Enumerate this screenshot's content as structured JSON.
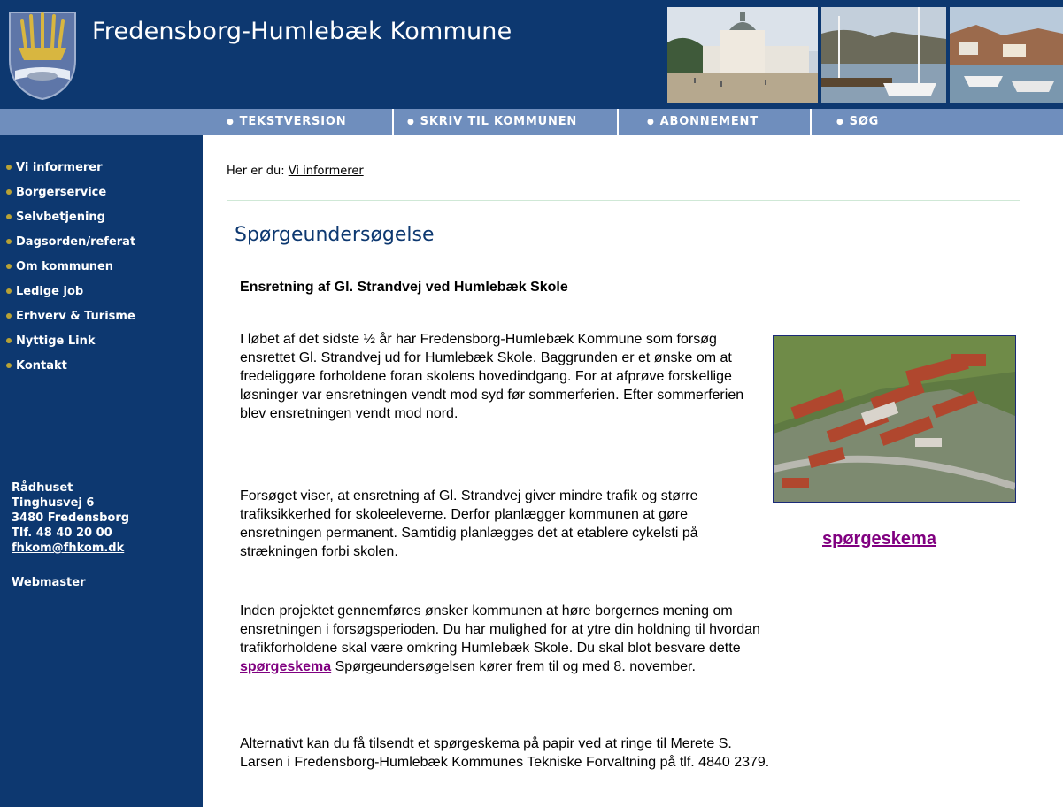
{
  "header": {
    "title": "Fredensborg-Humlebæk Kommune"
  },
  "nav": [
    {
      "label": "TEKSTVERSION"
    },
    {
      "label": "SKRIV TIL KOMMUNEN"
    },
    {
      "label": "ABONNEMENT"
    },
    {
      "label": "SØG"
    }
  ],
  "sidebar": {
    "items": [
      {
        "label": "Vi informerer"
      },
      {
        "label": "Borgerservice"
      },
      {
        "label": "Selvbetjening"
      },
      {
        "label": "Dagsorden/referat"
      },
      {
        "label": "Om kommunen"
      },
      {
        "label": "Ledige job"
      },
      {
        "label": "Erhverv & Turisme"
      },
      {
        "label": "Nyttige Link"
      },
      {
        "label": "Kontakt"
      }
    ],
    "address": {
      "line1": "Rådhuset",
      "line2": "Tinghusvej 6",
      "line3": "3480 Fredensborg",
      "phone": "Tlf. 48 40 20 00",
      "email": "fhkom@fhkom.dk"
    },
    "webmaster": "Webmaster"
  },
  "breadcrumb": {
    "prefix": "Her er du:",
    "link": "Vi informerer"
  },
  "main": {
    "title": "Spørgeundersøgelse",
    "subtitle": "Ensretning af Gl. Strandvej ved Humlebæk Skole",
    "para1": "I løbet af det sidste ½ år har Fredensborg-Humlebæk Kommune som forsøg ensrettet Gl. Strandvej ud for Humlebæk Skole. Baggrunden er et ønske om at fredeliggøre forholdene foran skolens hovedindgang. For at afprøve forskellige løsninger var ensretningen vendt mod syd før sommerferien. Efter sommerferien blev ensretningen vendt mod nord.",
    "para2": "Forsøget viser, at ensretning af Gl. Strandvej giver mindre trafik og større trafiksikkerhed for skoleeleverne. Derfor planlægger kommunen at gøre ensretningen permanent. Samtidig planlægges det at etablere cykelsti på strækningen forbi skolen.",
    "para3_before": "Inden projektet gennemføres ønsker kommunen at høre borgernes mening om ensretningen i forsøgsperioden. Du har mulighed for at ytre din holdning til hvordan trafikforholdene skal være omkring Humlebæk Skole. Du skal blot besvare dette",
    "para3_link": "spørgeskema",
    "para3_after": "Spørgeundersøgelsen kører frem til og med 8. november.",
    "para4": "Alternativt kan du få tilsendt et spørgeskema på papir ved at ringe til Merete S. Larsen i Fredensborg-Humlebæk Kommunes Tekniske Forvaltning på tlf. 4840 2379.",
    "side_link": "spørgeskema"
  },
  "colors": {
    "navy": "#0d3870",
    "navbar": "#6f8ebd",
    "bullet": "#b8a235",
    "visited_link": "#800080"
  }
}
